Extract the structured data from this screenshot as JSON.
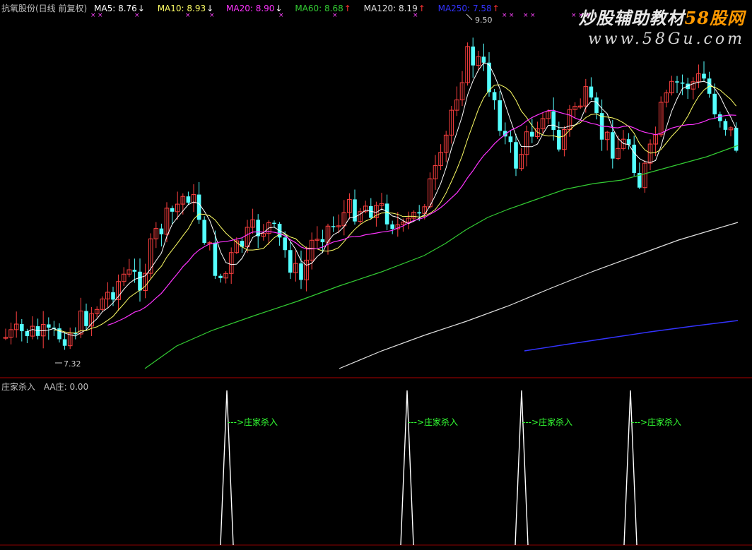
{
  "header": {
    "title": "抗氧股份(日线 前复权)",
    "indicators": [
      {
        "label": "MA5:",
        "value": "8.76",
        "arrow": "↓",
        "color": "#ffffff",
        "arrow_color": "#ffffff"
      },
      {
        "label": "MA10:",
        "value": "8.93",
        "arrow": "↓",
        "color": "#ffff66",
        "arrow_color": "#ffffff"
      },
      {
        "label": "MA20:",
        "value": "8.90",
        "arrow": "↓",
        "color": "#ff33ff",
        "arrow_color": "#ffffff"
      },
      {
        "label": "MA60:",
        "value": "8.68",
        "arrow": "↑",
        "color": "#33cc33",
        "arrow_color": "#ff3333"
      },
      {
        "label": "MA120:",
        "value": "8.19",
        "arrow": "↑",
        "color": "#e0e0e0",
        "arrow_color": "#ff3333"
      },
      {
        "label": "MA250:",
        "value": "7.58",
        "arrow": "↑",
        "color": "#3333ff",
        "arrow_color": "#ff3333"
      }
    ]
  },
  "annotations": {
    "high": "9.50",
    "low": "7.32"
  },
  "sub_panel": {
    "name": "庄家杀入",
    "indicator_label": "AA庄:",
    "indicator_value": "0.00",
    "signal_label": "--->庄家杀入",
    "signal_count": 4
  },
  "watermark": {
    "line1": "炒股辅助教材",
    "line1_brand": "58股网",
    "line2": "www.58Gu.com"
  },
  "colors": {
    "background": "#000000",
    "up_candle": "#ff4040",
    "down_candle": "#54ffff",
    "ma5": "#ffffff",
    "ma10": "#ffff66",
    "ma20": "#ff33ff",
    "ma60": "#33cc33",
    "ma120": "#e0e0e0",
    "ma250": "#3333ff",
    "signal_text": "#33ff33",
    "grid": "#8b0000"
  }
}
